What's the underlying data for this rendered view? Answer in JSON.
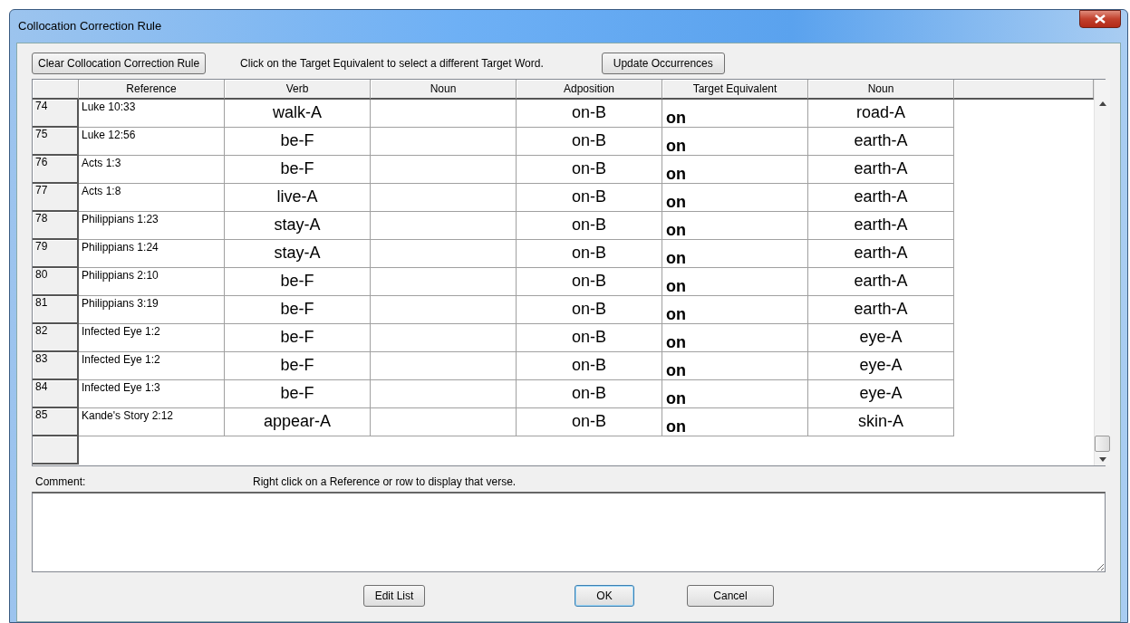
{
  "window": {
    "title": "Collocation Correction Rule"
  },
  "toolbar": {
    "clear_button": "Clear Collocation Correction Rule",
    "hint": "Click on the Target Equivalent to select a different Target Word.",
    "update_button": "Update Occurrences"
  },
  "table": {
    "columns": [
      "Reference",
      "Verb",
      "Noun",
      "Adposition",
      "Target Equivalent",
      "Noun"
    ],
    "rows": [
      {
        "number": "74",
        "cells": [
          "Luke 10:33",
          "walk-A",
          null,
          "on-B",
          "on",
          "road-A"
        ]
      },
      {
        "number": "75",
        "cells": [
          "Luke 12:56",
          "be-F",
          null,
          "on-B",
          "on",
          "earth-A"
        ]
      },
      {
        "number": "76",
        "cells": [
          "Acts 1:3",
          "be-F",
          null,
          "on-B",
          "on",
          "earth-A"
        ]
      },
      {
        "number": "77",
        "cells": [
          "Acts 1:8",
          "live-A",
          null,
          "on-B",
          "on",
          "earth-A"
        ]
      },
      {
        "number": "78",
        "cells": [
          "Philippians 1:23",
          "stay-A",
          null,
          "on-B",
          "on",
          "earth-A"
        ]
      },
      {
        "number": "79",
        "cells": [
          "Philippians 1:24",
          "stay-A",
          null,
          "on-B",
          "on",
          "earth-A"
        ]
      },
      {
        "number": "80",
        "cells": [
          "Philippians 2:10",
          "be-F",
          null,
          "on-B",
          "on",
          "earth-A"
        ]
      },
      {
        "number": "81",
        "cells": [
          "Philippians 3:19",
          "be-F",
          null,
          "on-B",
          "on",
          "earth-A"
        ]
      },
      {
        "number": "82",
        "cells": [
          "Infected Eye 1:2",
          "be-F",
          null,
          "on-B",
          "on",
          "eye-A"
        ]
      },
      {
        "number": "83",
        "cells": [
          "Infected Eye 1:2",
          "be-F",
          null,
          "on-B",
          "on",
          "eye-A"
        ]
      },
      {
        "number": "84",
        "cells": [
          "Infected Eye 1:3",
          "be-F",
          null,
          "on-B",
          "on",
          "eye-A"
        ]
      },
      {
        "number": "85",
        "cells": [
          "Kande's Story 2:12",
          "appear-A",
          null,
          "on-B",
          "on",
          "skin-A"
        ]
      }
    ]
  },
  "comment": {
    "label": "Comment:",
    "hint": "Right click on a Reference or row to display that verse."
  },
  "buttons": [
    {
      "label": "Edit List",
      "default": false
    },
    {
      "label": "OK",
      "default": true
    },
    {
      "label": "Cancel",
      "default": false
    }
  ]
}
